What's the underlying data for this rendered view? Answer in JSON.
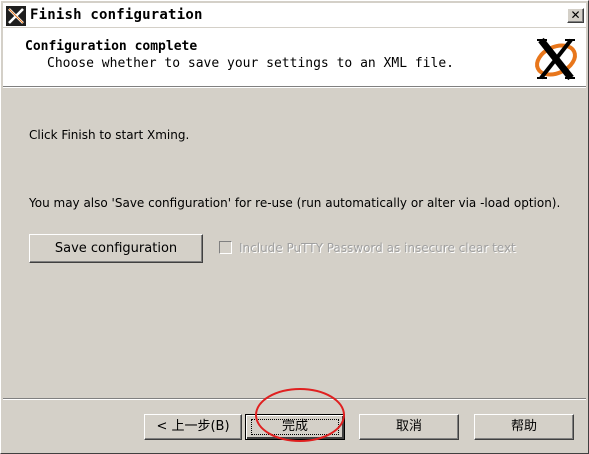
{
  "window": {
    "title": "Finish configuration",
    "close_glyph": "✕",
    "app_icon": "xming-icon"
  },
  "header": {
    "title": "Configuration complete",
    "subtitle": "Choose whether to save your settings to an XML file.",
    "logo": "xming-logo"
  },
  "body": {
    "click_finish_text": "Click Finish to start Xming.",
    "save_info_text": "You may also 'Save configuration' for re-use (run automatically or alter via -load option).",
    "save_button_label": "Save configuration",
    "putty_checkbox_label": "Include PuTTY Password as insecure clear text",
    "putty_checkbox_checked": false,
    "putty_checkbox_enabled": false
  },
  "footer": {
    "back_label": "< 上一步(B)",
    "finish_label": "完成",
    "cancel_label": "取消",
    "help_label": "帮助"
  },
  "colors": {
    "dialog_bg": "#d4d0c8",
    "annotation": "#e02020",
    "logo_orange": "#e8761b"
  }
}
